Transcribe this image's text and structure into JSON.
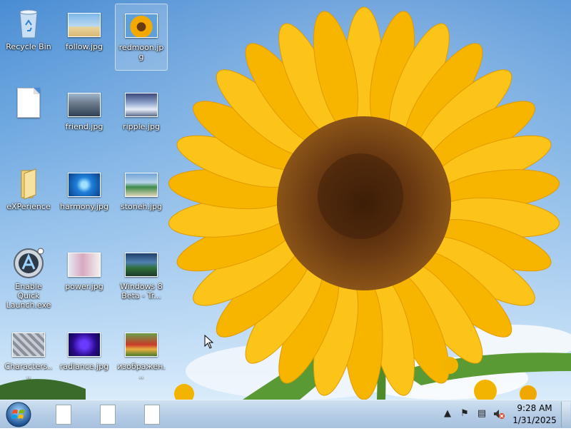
{
  "desktop_icons": [
    {
      "label": "Recycle Bin",
      "icon": "recycle-bin-icon"
    },
    {
      "label": "follow.jpg",
      "icon": "image-file-icon"
    },
    {
      "label": "redmoon.jpg",
      "icon": "image-file-icon",
      "selected": true
    },
    {
      "label": "",
      "icon": "blank-document-icon"
    },
    {
      "label": "friend.jpg",
      "icon": "image-file-icon"
    },
    {
      "label": "ripple.jpg",
      "icon": "image-file-icon"
    },
    {
      "label": "eXPerience",
      "icon": "folder-icon"
    },
    {
      "label": "harmony.jpg",
      "icon": "image-file-icon"
    },
    {
      "label": "stoneh.jpg",
      "icon": "image-file-icon"
    },
    {
      "label": "Enable Quick Launch.exe",
      "icon": "quick-launch-app-icon"
    },
    {
      "label": "power.jpg",
      "icon": "image-file-icon"
    },
    {
      "label": "Windows 8 Beta - Tr...",
      "icon": "image-file-icon"
    },
    {
      "label": "Characters....",
      "icon": "image-file-icon"
    },
    {
      "label": "radiance.jpg",
      "icon": "image-file-icon"
    },
    {
      "label": "изображен...",
      "icon": "image-file-icon"
    }
  ],
  "taskbar": {
    "start_icon": "windows-orb-icon",
    "pinned": [
      "document-icon",
      "document-icon",
      "document-icon"
    ],
    "tray_icons": [
      "tray-overflow-chevron-icon",
      "action-center-flag-icon",
      "network-icon",
      "volume-muted-icon"
    ],
    "clock": {
      "time": "9:28 AM",
      "date": "1/31/2025"
    }
  },
  "colors": {
    "sky_top": "#3f86d1",
    "taskbar": "#b6cde6",
    "petal": "#f7b500",
    "seed_center": "#6b3a12"
  }
}
